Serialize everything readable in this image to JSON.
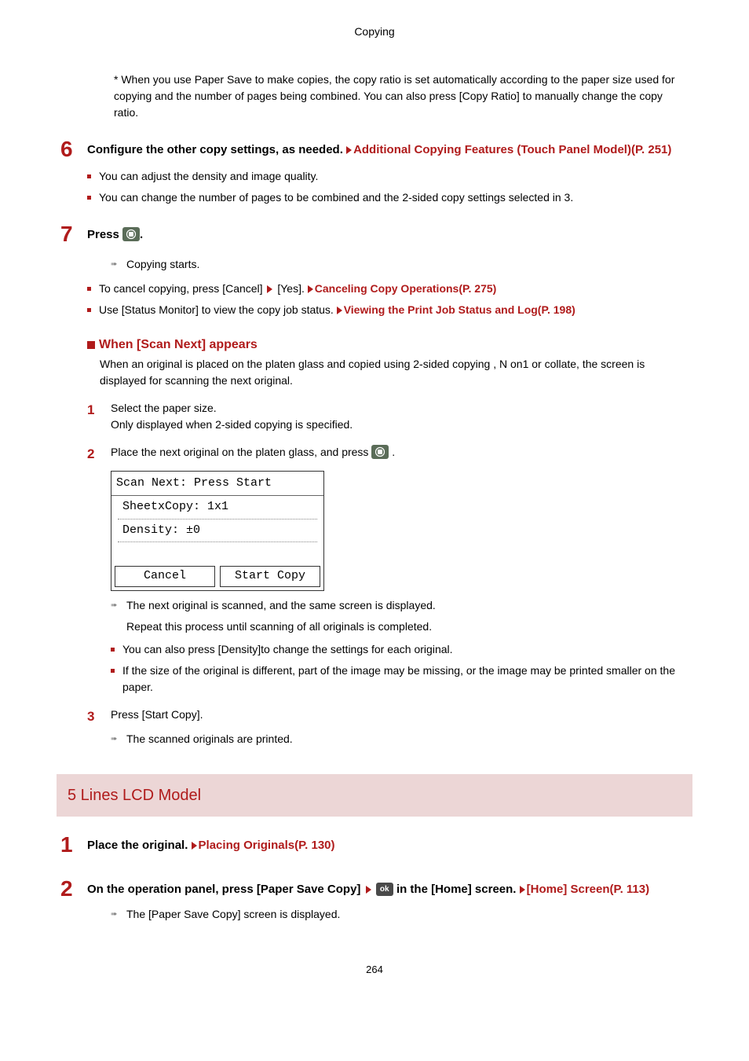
{
  "header": {
    "title": "Copying"
  },
  "intro_note": "* When you use Paper Save to make copies, the copy ratio is set automatically according to the paper size used for copying and the number of pages being combined. You can also press [Copy Ratio] to manually change the copy ratio.",
  "step6": {
    "num": "6",
    "text": "Configure the other copy settings, as needed. ",
    "link": "Additional Copying Features (Touch Panel Model)(P. 251)",
    "bullets": [
      "You can adjust the density and image quality.",
      "You can change the number of pages to be combined and the 2-sided copy settings selected in 3."
    ]
  },
  "step7": {
    "num": "7",
    "text_pre": "Press ",
    "text_post": ".",
    "arrow1": "Copying starts.",
    "bullet1_pre": "To cancel copying, press [Cancel] ",
    "bullet1_mid": " [Yes]. ",
    "bullet1_link": "Canceling Copy Operations(P. 275)",
    "bullet2_pre": "Use [Status Monitor] to view the copy job status. ",
    "bullet2_link": "Viewing the Print Job Status and Log(P. 198)"
  },
  "scan_next": {
    "title": "When [Scan Next] appears",
    "body": "When an original is placed on the platen glass and copied using 2-sided copying , N on1 or collate, the screen is displayed for scanning the next original.",
    "sub1": {
      "num": "1",
      "line1": "Select the paper size.",
      "line2": "Only displayed when 2-sided copying is specified."
    },
    "sub2": {
      "num": "2",
      "pre": "Place the next original on the platen glass, and press ",
      "post": " .",
      "lcd": {
        "head": "Scan Next: Press Start",
        "row1": "SheetxCopy: 1x1",
        "row2": "Density: ±0",
        "btn_cancel": "Cancel",
        "btn_start": "Start Copy"
      },
      "arrow1": "The next original is scanned, and the same screen is displayed.",
      "arrow1b": "Repeat this process until scanning of all originals is completed.",
      "bullets": [
        "You can also press [Density]to change the settings for each original.",
        "If the size of the original is different, part of the image may be missing, or the image may be printed smaller on the paper."
      ]
    },
    "sub3": {
      "num": "3",
      "line1": "Press [Start Copy].",
      "arrow": "The scanned originals are printed."
    }
  },
  "section_5lines": {
    "title": "5 Lines LCD Model",
    "step1": {
      "num": "1",
      "pre": "Place the original. ",
      "link": "Placing Originals(P. 130)"
    },
    "step2": {
      "num": "2",
      "pre": "On the operation panel, press [Paper Save Copy] ",
      "mid": " ",
      "ok_label": "ok",
      "post": " in the [Home] screen. ",
      "link": "[Home] Screen(P. 113)",
      "arrow": "The [Paper Save Copy] screen is displayed."
    }
  },
  "page_number": "264"
}
